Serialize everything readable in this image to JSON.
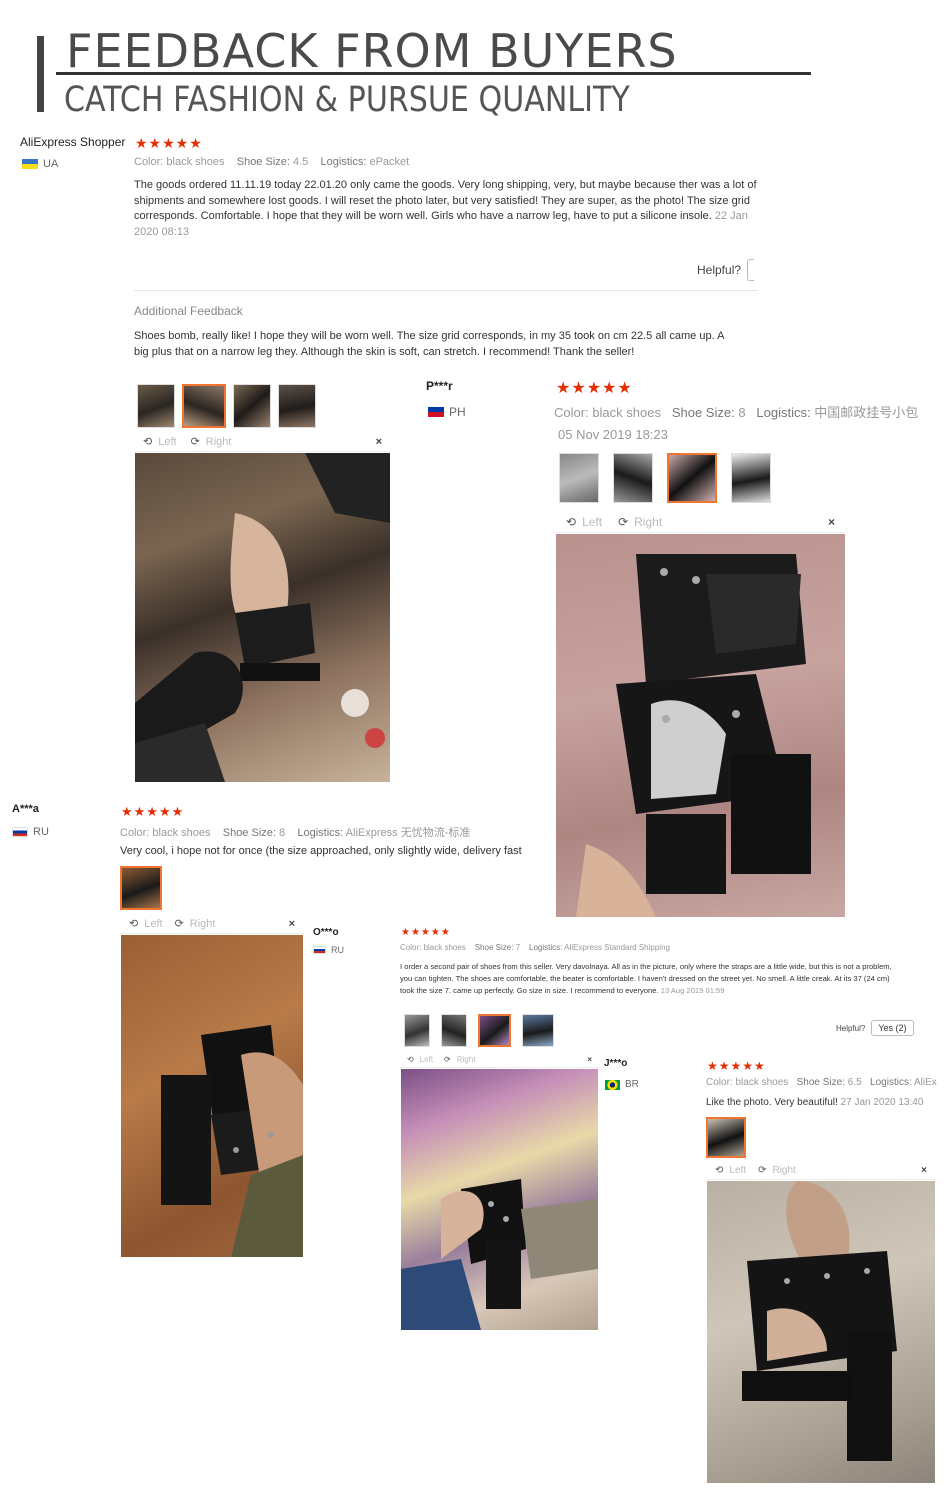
{
  "header": {
    "title": "FEEDBACK FROM BUYERS",
    "subtitle": "CATCH FASHION & PURSUE QUANLITY"
  },
  "colors": {
    "stars": "#e62e04",
    "accent": "#f07530",
    "header": "#444444"
  },
  "reviews": [
    {
      "name": "AliExpress Shopper",
      "country": "UA",
      "stars": "★★★★★",
      "color_label": "Color:",
      "color": "black shoes",
      "size_label": "Shoe Size:",
      "size": "4.5",
      "logistics_label": "Logistics:",
      "logistics": "ePacket",
      "text": "The goods ordered 11.11.19 today 22.01.20 only came the goods. Very long shipping, very, but maybe because ther was a lot of shipments and somewhere lost goods. I will reset the photo later, but very satisfied! They are super, as the photo! The size grid corresponds. Comfortable. I hope that they will be worn well. Girls who have a narrow leg, have to put a silicone insole.",
      "date": "22 Jan 2020 08:13",
      "helpful": "Helpful?",
      "additional_label": "Additional Feedback",
      "additional_text": "Shoes bomb, really like! I hope they will be worn well. The size grid corresponds, in my 35 took on cm 22.5 all came up. A big plus that on a narrow leg they. Although the skin is soft, can stretch. I recommend! Thank the seller!",
      "tool_left": "Left",
      "tool_right": "Right",
      "close": "×"
    },
    {
      "name": "P***r",
      "country": "PH",
      "stars": "★★★★★",
      "color_label": "Color:",
      "color": "black shoes",
      "size_label": "Shoe Size:",
      "size": "8",
      "logistics_label": "Logistics:",
      "logistics": "中国邮政挂号小包",
      "date": "05 Nov 2019 18:23",
      "tool_left": "Left",
      "tool_right": "Right",
      "close": "×"
    },
    {
      "name": "A***a",
      "country": "RU",
      "stars": "★★★★★",
      "color_label": "Color:",
      "color": "black shoes",
      "size_label": "Shoe Size:",
      "size": "8",
      "logistics_label": "Logistics:",
      "logistics": "AliExpress 无忧物流-标准",
      "text": "Very cool, i hope not for once (the size approached, only slightly wide, delivery fast",
      "tool_left": "Left",
      "tool_right": "Right",
      "close": "×"
    },
    {
      "name": "O***o",
      "country": "RU",
      "stars": "★★★★★",
      "color_label": "Color:",
      "color": "black shoes",
      "size_label": "Shoe Size:",
      "size": "7",
      "logistics_label": "Logistics:",
      "logistics": "AliExpress Standard Shipping",
      "text": "I order a second pair of shoes from this seller. Very davolnaya. All as in the picture, only where the straps are a little wide, but this is not a problem, you can tighten. The shoes are comfortable, the beater is comfortable. I haven't dressed on the street yet. No smell. A little creak. At its 37 (24 cm) took the size 7. came up perfectly. Go size in size. I recommend to everyone.",
      "date": "13 Aug 2019 01:59",
      "helpful": "Helpful?",
      "yes": "Yes (2)",
      "tool_left": "Left",
      "tool_right": "Right",
      "close": "×"
    },
    {
      "name": "J***o",
      "country": "BR",
      "stars": "★★★★★",
      "color_label": "Color:",
      "color": "black shoes",
      "size_label": "Shoe Size:",
      "size": "6.5",
      "logistics_label": "Logistics:",
      "logistics": "AliEx",
      "text": "Like the photo. Very beautiful!",
      "date": "27 Jan 2020 13:40",
      "tool_left": "Left",
      "tool_right": "Right",
      "close": "×"
    }
  ]
}
